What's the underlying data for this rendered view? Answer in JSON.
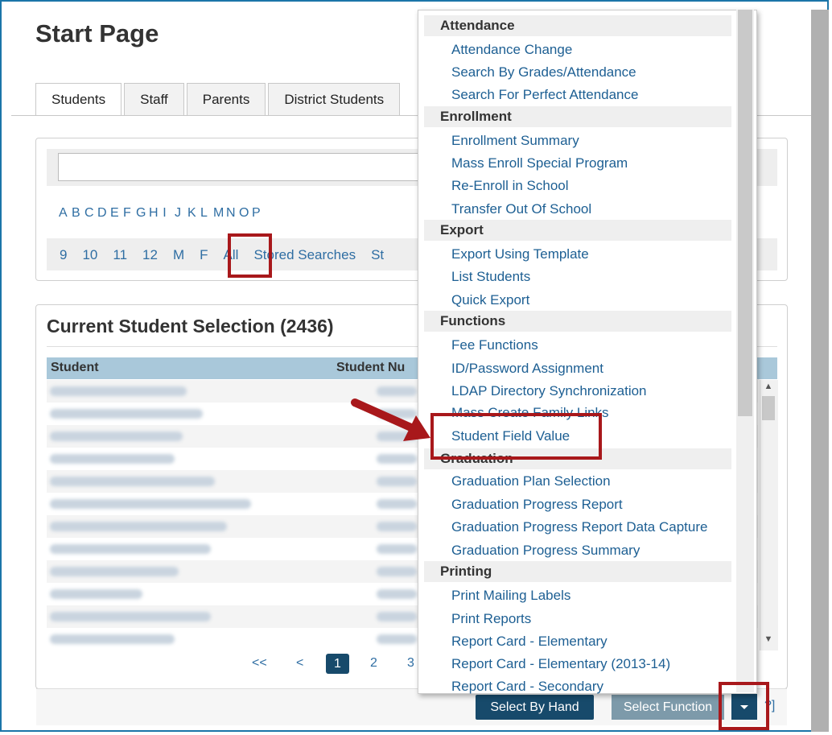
{
  "page": {
    "title": "Start Page"
  },
  "tabs": [
    {
      "label": "Students"
    },
    {
      "label": "Staff"
    },
    {
      "label": "Parents"
    },
    {
      "label": "District Students"
    }
  ],
  "search": {
    "letters": [
      "A",
      "B",
      "C",
      "D",
      "E",
      "F",
      "G",
      "H",
      "I",
      "J",
      "K",
      "L",
      "M",
      "N",
      "O",
      "P"
    ],
    "grades": [
      "9",
      "10",
      "11",
      "12",
      "M",
      "F",
      "All",
      "Stored Searches",
      "St"
    ]
  },
  "selection": {
    "title": "Current Student Selection (2436)",
    "columns": [
      "Student",
      "Student Nu"
    ],
    "pager": {
      "first": "<<",
      "prev": "<",
      "current": "1",
      "p2": "2",
      "p3": "3"
    }
  },
  "footer": {
    "select_by_hand": "Select By Hand",
    "select_function": "Select Function",
    "help": "?]"
  },
  "dropdown": {
    "groups": [
      {
        "label": "Attendance",
        "items": [
          "Attendance Change",
          "Search By Grades/Attendance",
          "Search For Perfect Attendance"
        ]
      },
      {
        "label": "Enrollment",
        "items": [
          "Enrollment Summary",
          "Mass Enroll Special Program",
          "Re-Enroll in School",
          "Transfer Out Of School"
        ]
      },
      {
        "label": "Export",
        "items": [
          "Export Using Template",
          "List Students",
          "Quick Export"
        ]
      },
      {
        "label": "Functions",
        "items": [
          "Fee Functions",
          "ID/Password Assignment",
          "LDAP Directory Synchronization",
          "Mass Create Family Links",
          "Student Field Value"
        ]
      },
      {
        "label": "Graduation",
        "items": [
          "Graduation Plan Selection",
          "Graduation Progress Report",
          "Graduation Progress Report Data Capture",
          "Graduation Progress Summary"
        ]
      },
      {
        "label": "Printing",
        "items": [
          "Print Mailing Labels",
          "Print Reports",
          "Report Card - Elementary",
          "Report Card - Elementary (2013-14)",
          "Report Card - Secondary"
        ]
      }
    ]
  },
  "colors": {
    "accent": "#174a6b",
    "link": "#1d5f93",
    "highlight": "#a8181b",
    "table_header": "#a9c8da"
  }
}
